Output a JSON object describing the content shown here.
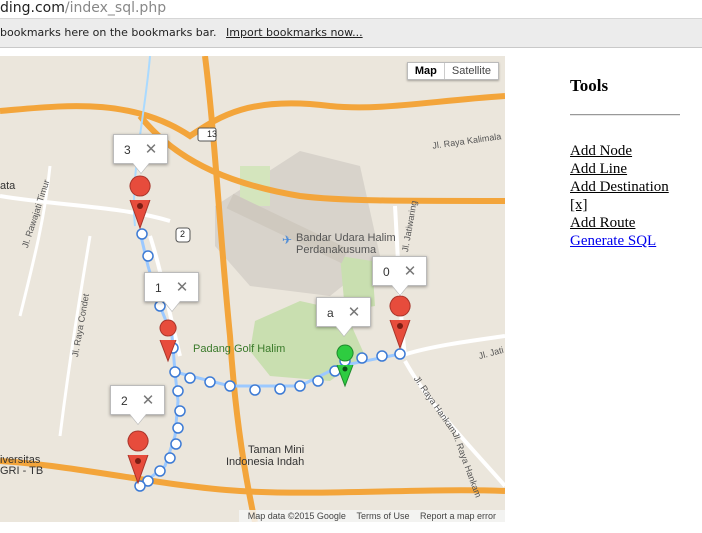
{
  "browser": {
    "url_domain": "ding.com",
    "url_path": "/index_sql.php",
    "bookmarks_text": "bookmarks here on the bookmarks bar.",
    "bookmarks_link": "Import bookmarks now..."
  },
  "map": {
    "map_type_map": "Map",
    "map_type_satellite": "Satellite",
    "attribution_data": "Map data ©2015 Google",
    "attribution_terms": "Terms of Use",
    "attribution_report": "Report a map error",
    "place_labels": {
      "airport": "Bandar Udara Halim",
      "airport2": "Perdanakusuma",
      "golf": "Padang Golf Halim",
      "taman": "Taman Mini",
      "taman2": "Indonesia Indah",
      "road_kalimalang": "Jl. Raya Kalimala",
      "road_rawajati": "Jl. Rawajati Timur",
      "road_condet": "Jl. Raya Condet",
      "road_jatiwaringin": "Jl. Jatiwaring",
      "road_jatimakmur": "Jl. Jati Ma",
      "road_hankam": "Jl. Raya Hankam",
      "road_hankam2": "Jl. Raya Hankam",
      "area_ata": "ata",
      "area_univ": "iversitas",
      "area_univ2": "GRI - TB",
      "shield_13": "13",
      "shield_2": "2"
    },
    "markers": [
      {
        "id": "0",
        "color": "#e74c3c"
      },
      {
        "id": "1",
        "color": "#e74c3c"
      },
      {
        "id": "2",
        "color": "#e74c3c"
      },
      {
        "id": "3",
        "color": "#e74c3c"
      },
      {
        "id": "a",
        "color": "#2ecc40"
      }
    ],
    "info_windows": [
      {
        "label": "3",
        "close": "✕"
      },
      {
        "label": "1",
        "close": "✕"
      },
      {
        "label": "2",
        "close": "✕"
      },
      {
        "label": "a",
        "close": "✕"
      },
      {
        "label": "0",
        "close": "✕"
      }
    ]
  },
  "tools": {
    "title": "Tools",
    "items": [
      {
        "label": "Add Node"
      },
      {
        "label": "Add Line"
      },
      {
        "label": "Add Destination"
      },
      {
        "label": "[x]"
      },
      {
        "label": "Add Route"
      },
      {
        "label": "Generate SQL"
      }
    ]
  }
}
